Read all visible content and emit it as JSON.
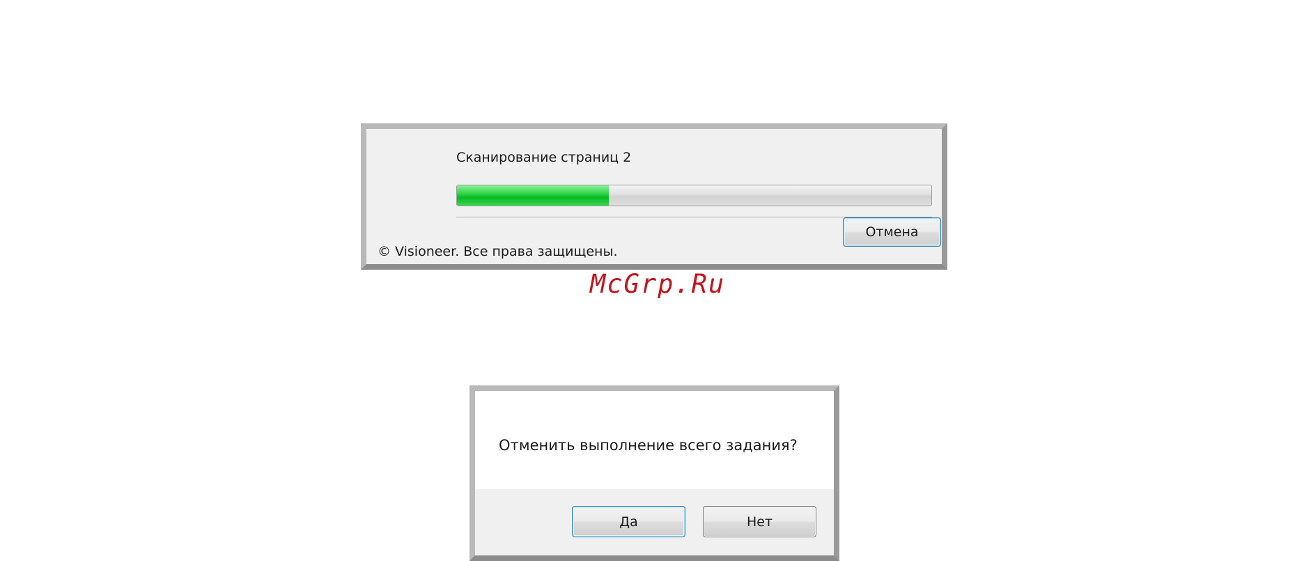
{
  "progress_dialog": {
    "status_text": "Сканирование страниц 2",
    "progress_fraction": 0.32,
    "accent_color": "#07b922",
    "cancel_label": "Отмена",
    "copyright_text": "© Visioneer. Все права защищены."
  },
  "watermark": {
    "text": "McGrp.Ru"
  },
  "confirm_dialog": {
    "question": "Отменить выполнение всего задания?",
    "yes_label": "Да",
    "no_label": "Нет"
  }
}
